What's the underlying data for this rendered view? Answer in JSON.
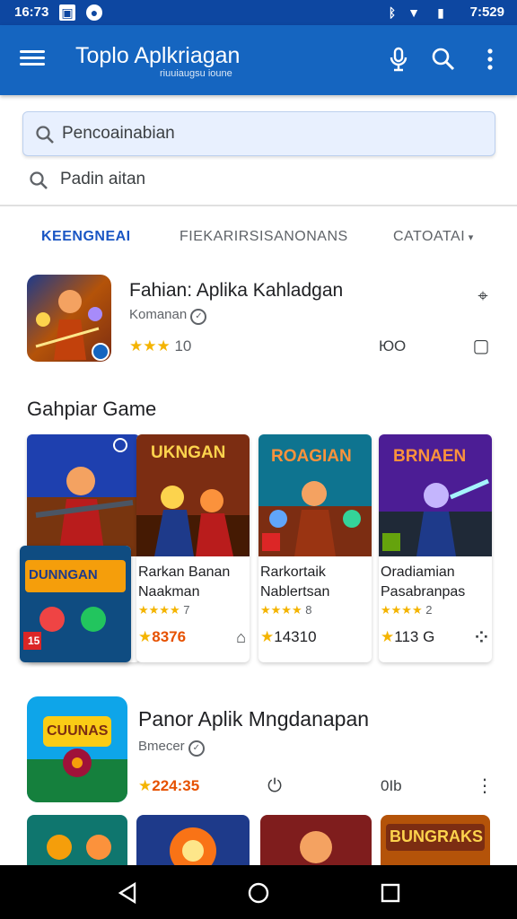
{
  "status_bar": {
    "time_left": "16:73",
    "time_right": "7:529",
    "icons": [
      "image-icon",
      "notification-icon",
      "bluetooth-icon",
      "wifi-icon",
      "battery-icon"
    ]
  },
  "app_bar": {
    "title": "Toplo Aplkriagan",
    "subtitle": "riuuiaugsu ioune",
    "icons": [
      "menu-icon",
      "mic-icon",
      "search-icon",
      "more-vert-icon"
    ],
    "color": "#1565c0"
  },
  "search": {
    "primary_placeholder": "Pencoainabian",
    "secondary_text": "Padin aitan"
  },
  "tabs": [
    {
      "label": "KEENGNEAI",
      "active": true
    },
    {
      "label": "FIEKARIRSISANONANS",
      "active": false
    },
    {
      "label": "CATOATAI",
      "active": false
    }
  ],
  "featured": {
    "title": "Fahian: Aplika Kahladgan",
    "developer": "Komanan",
    "rating": "10",
    "action_label": "ЮО"
  },
  "section": {
    "title": "Gahpiar Game"
  },
  "games": [
    {
      "name": "",
      "stars_label": "",
      "count": ""
    },
    {
      "name": "Rarkan Banan Naakman",
      "stars_label": "7",
      "count": "8376"
    },
    {
      "name": "Rarkortaik Nablertsan",
      "stars_label": "8",
      "count": "14310"
    },
    {
      "name": "Oradiamian Pasabranpas",
      "stars_label": "2",
      "count": "113 G"
    }
  ],
  "card_art_labels": [
    "",
    "UKNGAN",
    "ROAGIAN",
    "BRNAEN"
  ],
  "overlay_card": {
    "art_label": "DUNNGAN",
    "badge": "15"
  },
  "bottom_app": {
    "title": "Panor Aplik Mngdanapan",
    "developer": "Bmecer",
    "rating": "224:35",
    "action_label": "0Ib",
    "art_label": "CUUNAS"
  },
  "bottom_row_labels": [
    "",
    "",
    "",
    "BUNGRAKS"
  ],
  "accent_colors": {
    "primary": "#1565c0",
    "status_bar": "#0d47a1",
    "star": "#f4b400",
    "count": "#e65100",
    "active_tab": "#1a56c4"
  }
}
